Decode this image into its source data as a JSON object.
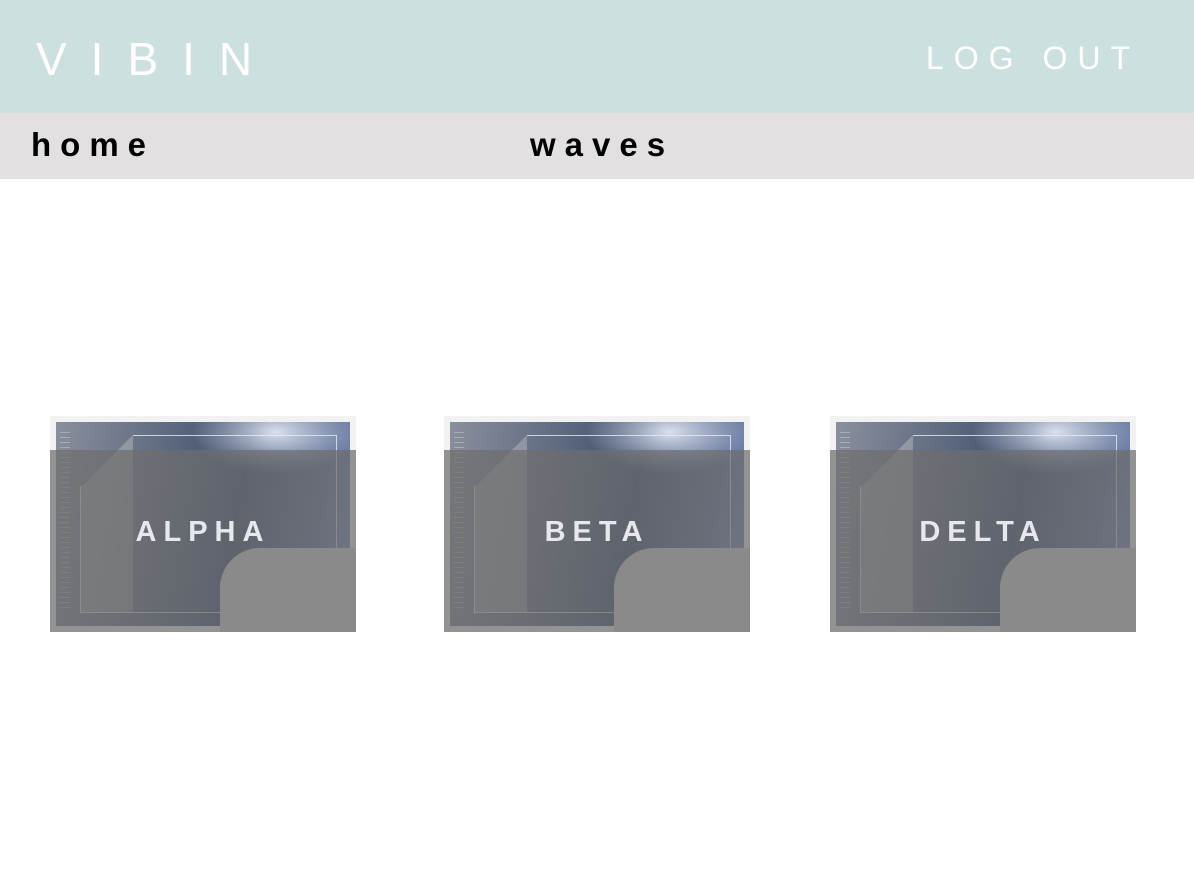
{
  "header": {
    "brand": "VIBIN",
    "logout_label": "LOG OUT",
    "background_color": "#cde0e0"
  },
  "nav": {
    "items": [
      {
        "label": "home"
      },
      {
        "label": "waves"
      }
    ],
    "background_color": "#e3e0e1"
  },
  "cards": [
    {
      "label": "ALPHA"
    },
    {
      "label": "BETA"
    },
    {
      "label": "DELTA"
    }
  ]
}
